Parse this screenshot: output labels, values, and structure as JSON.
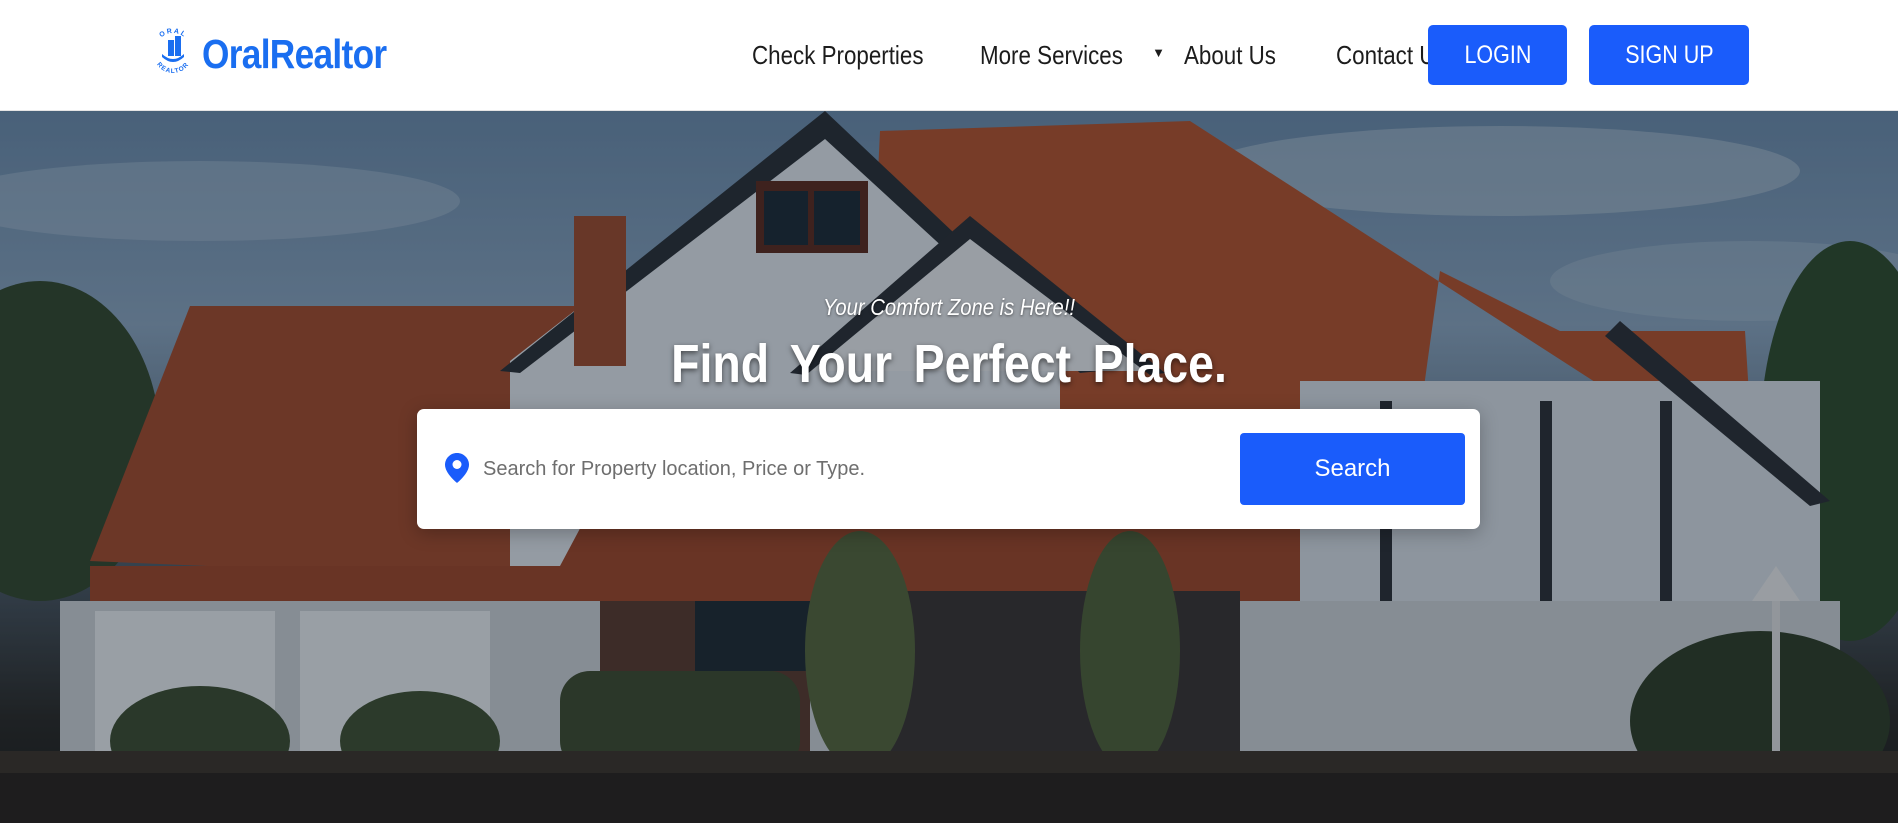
{
  "brand": {
    "name": "OralRealtor",
    "badge_top": "ORAL",
    "badge_bottom": "REALTOR",
    "accent_color": "#1a6ef0"
  },
  "nav": {
    "links": [
      "Check Properties",
      "More Services",
      "About Us",
      "Contact Us"
    ],
    "more_caret": "▼"
  },
  "auth": {
    "login_label": "LOGIN",
    "signup_label": "SIGN UP",
    "button_color": "#1a5cfb"
  },
  "hero": {
    "tagline": "Your Comfort Zone is Here!!",
    "headline": "Find Your Perfect Place.",
    "search": {
      "placeholder": "Search for Property location, Price or Type.",
      "value": "",
      "button_label": "Search",
      "icon": "map-pin-icon"
    }
  }
}
